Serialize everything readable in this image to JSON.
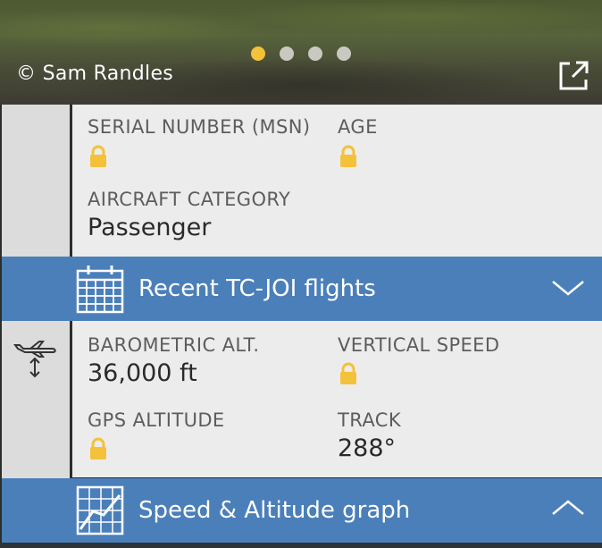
{
  "photo": {
    "credit": "© Sam Randles",
    "carousel_pages": 4,
    "active_page": 1,
    "external_link_icon": "external-link-icon"
  },
  "aircraft_info": {
    "serial_number_label": "SERIAL NUMBER (MSN)",
    "age_label": "AGE",
    "category_label": "AIRCRAFT CATEGORY",
    "category_value": "Passenger"
  },
  "recent_flights": {
    "title": "Recent TC-JOI flights",
    "icon": "calendar-icon",
    "expanded": false
  },
  "flight_data": {
    "baro_alt_label": "BAROMETRIC ALT.",
    "baro_alt_value": "36,000 ft",
    "vertical_speed_label": "VERTICAL SPEED",
    "gps_alt_label": "GPS ALTITUDE",
    "track_label": "TRACK",
    "track_value": "288°",
    "icon": "plane-altitude-icon"
  },
  "graph": {
    "title": "Speed & Altitude graph",
    "icon": "graph-icon",
    "expanded": true
  },
  "colors": {
    "accent_blue": "#4a7fba",
    "lock_yellow": "#f4c13a",
    "active_dot": "#f4c13a"
  }
}
